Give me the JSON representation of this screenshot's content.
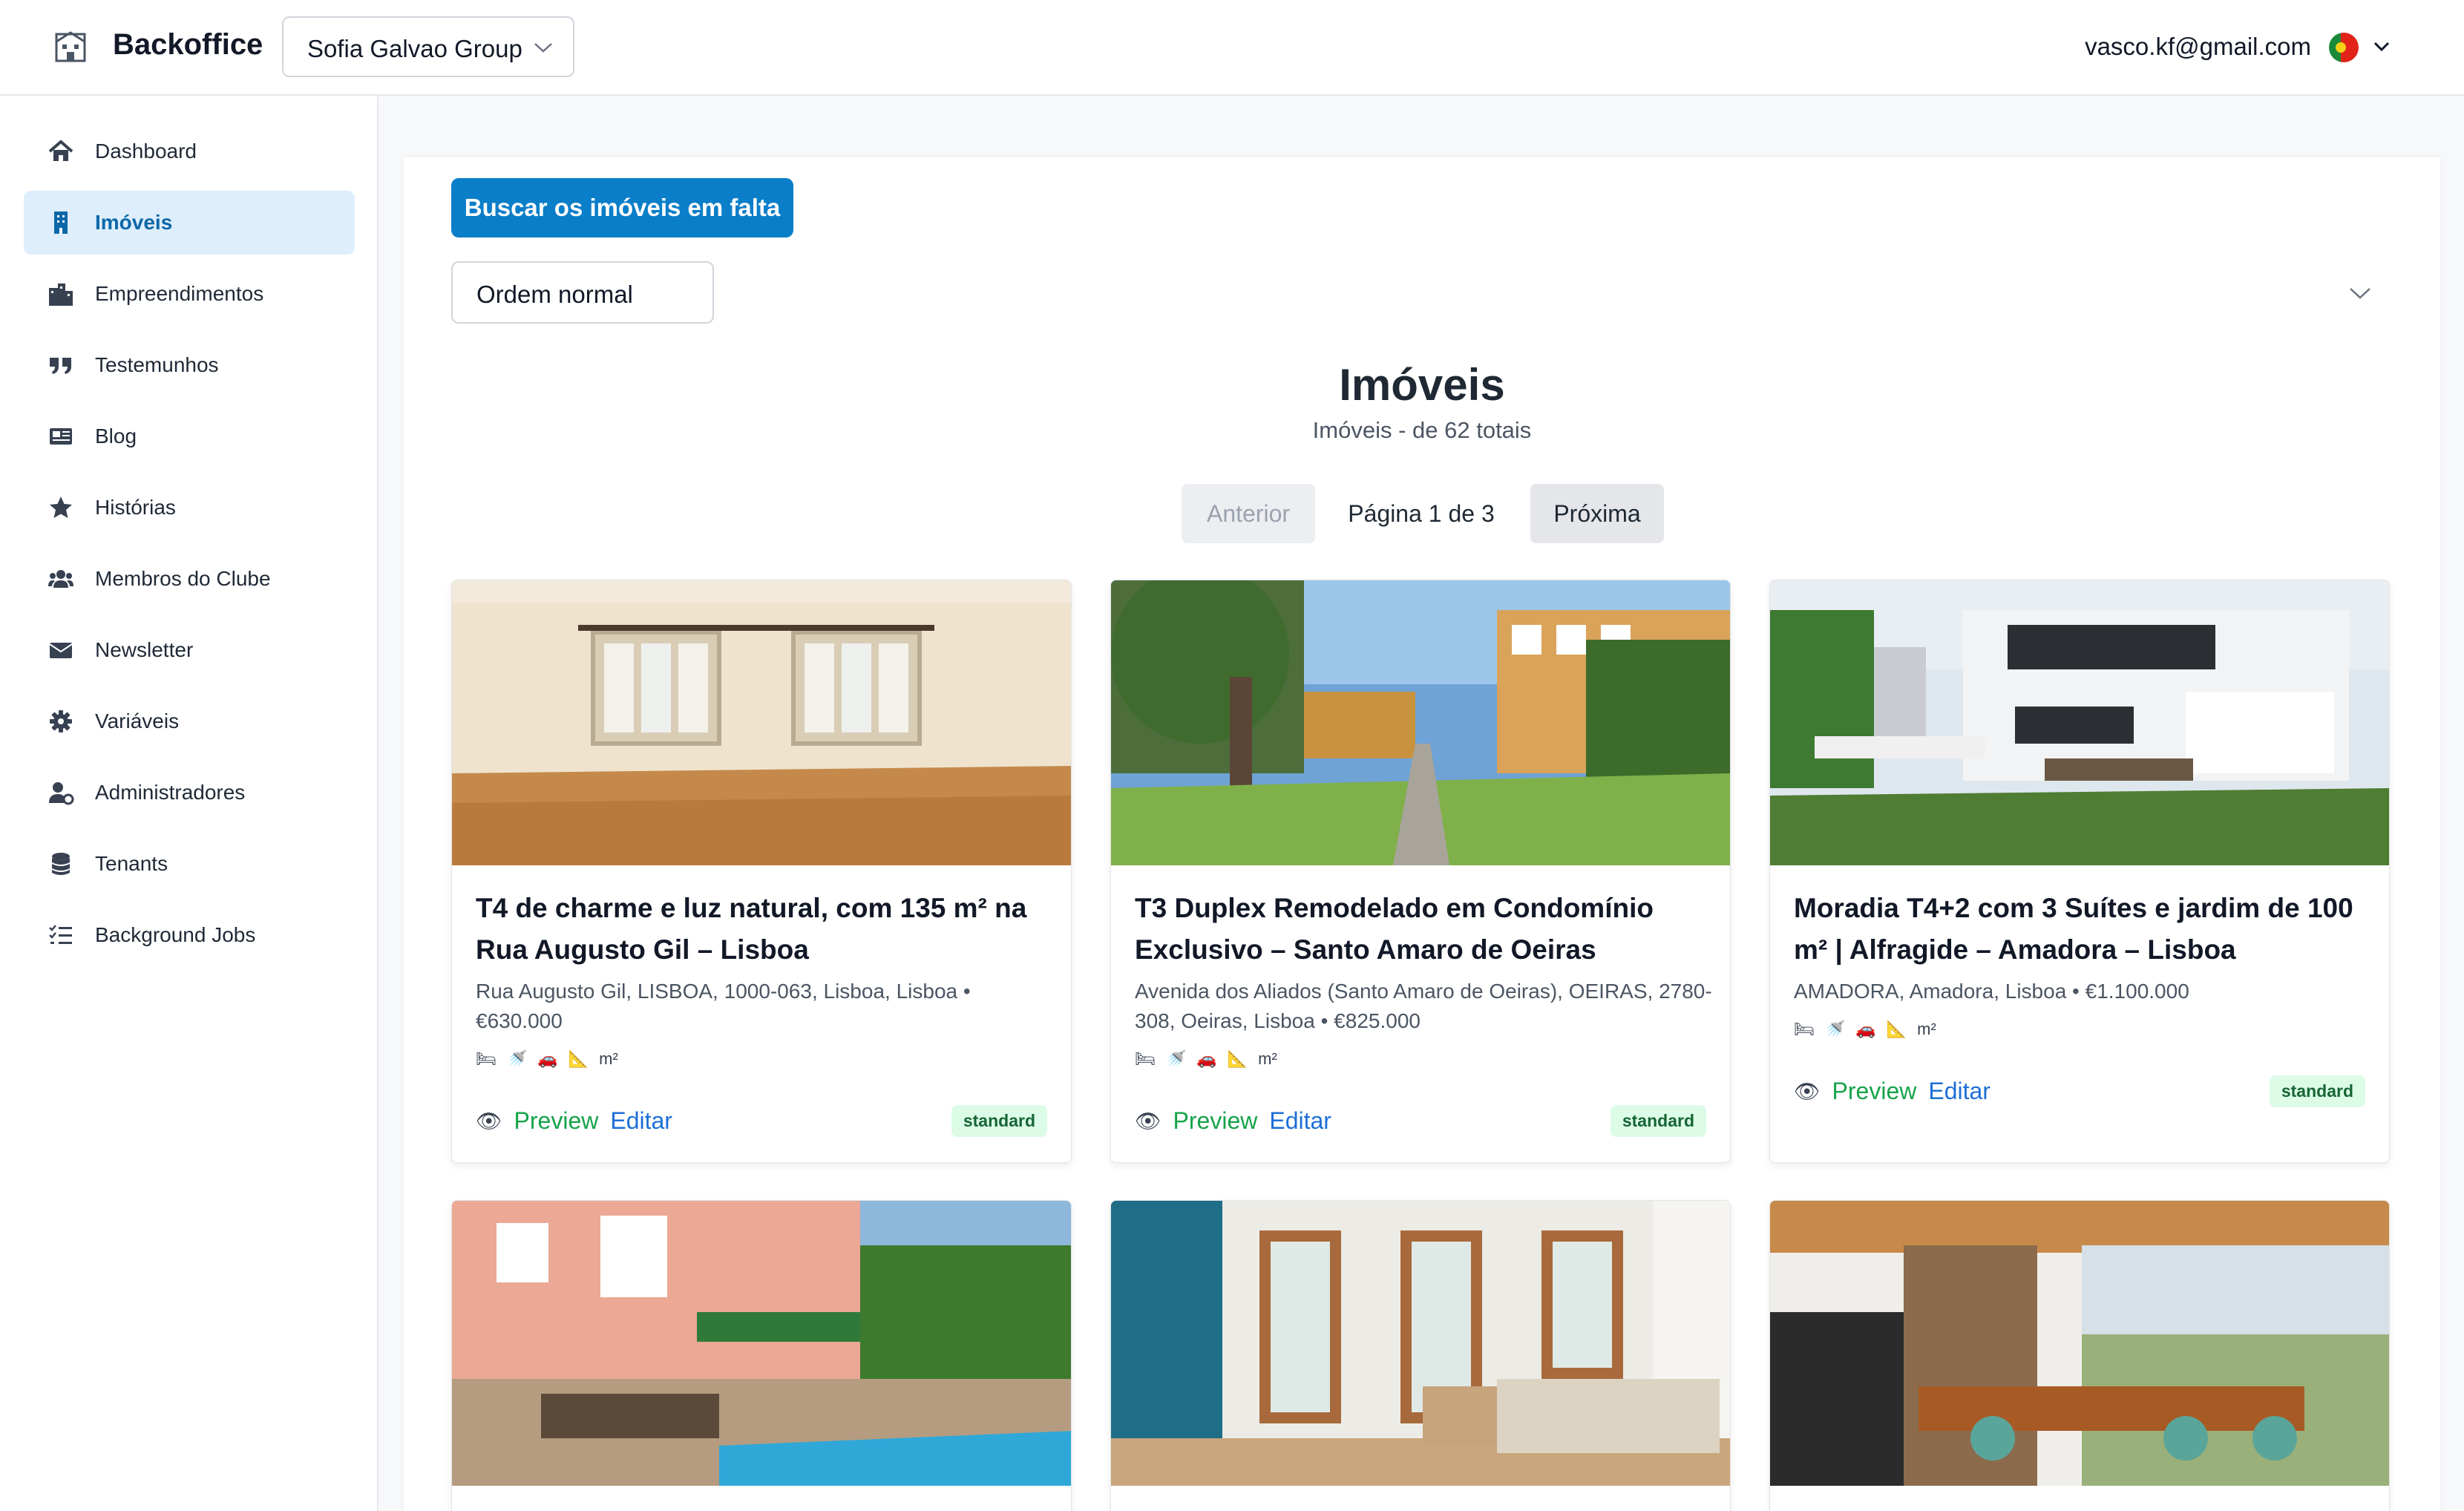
{
  "header": {
    "brand": "Backoffice",
    "tenant_select": "Sofia Galvao Group",
    "user_email": "vasco.kf@gmail.com"
  },
  "sidebar": {
    "items": [
      {
        "label": "Dashboard",
        "icon": "home-icon"
      },
      {
        "label": "Imóveis",
        "icon": "building-icon",
        "active": true
      },
      {
        "label": "Empreendimentos",
        "icon": "city-icon"
      },
      {
        "label": "Testemunhos",
        "icon": "quote-icon"
      },
      {
        "label": "Blog",
        "icon": "newspaper-icon"
      },
      {
        "label": "Histórias",
        "icon": "star-icon"
      },
      {
        "label": "Membros do Clube",
        "icon": "users-icon"
      },
      {
        "label": "Newsletter",
        "icon": "envelope-icon"
      },
      {
        "label": "Variáveis",
        "icon": "gear-icon"
      },
      {
        "label": "Administradores",
        "icon": "user-gear-icon"
      },
      {
        "label": "Tenants",
        "icon": "database-icon"
      },
      {
        "label": "Background Jobs",
        "icon": "list-check-icon"
      }
    ]
  },
  "main": {
    "fetch_button": "Buscar os imóveis em falta",
    "order_select": "Ordem normal",
    "title": "Imóveis",
    "subtitle": "Imóveis - de 62 totais",
    "pagination": {
      "prev": "Anterior",
      "info": "Página 1 de 3",
      "next": "Próxima"
    },
    "cards": [
      {
        "title": "T4 de charme e luz natural, com 135 m² na Rua Augusto Gil – Lisboa",
        "address": "Rua Augusto Gil, LISBOA, 1000-063, Lisboa, Lisboa • €630.000",
        "area_unit": "m²",
        "preview": "Preview",
        "edit": "Editar",
        "badge": "standard"
      },
      {
        "title": "T3 Duplex Remodelado em Condomínio Exclusivo – Santo Amaro de Oeiras",
        "address": "Avenida dos Aliados (Santo Amaro de Oeiras), OEIRAS, 2780-308, Oeiras, Lisboa • €825.000",
        "area_unit": "m²",
        "preview": "Preview",
        "edit": "Editar",
        "badge": "standard"
      },
      {
        "title": "Moradia T4+2 com 3 Suítes e jardim de 100 m² | Alfragide – Amadora – Lisboa",
        "address": "AMADORA, Amadora, Lisboa • €1.100.000",
        "area_unit": "m²",
        "preview": "Preview",
        "edit": "Editar",
        "badge": "standard"
      },
      {
        "title": "",
        "address": ""
      },
      {
        "title": "",
        "address": ""
      },
      {
        "title": "",
        "address": ""
      }
    ]
  },
  "colors": {
    "accent": "#0a7ec9",
    "active_bg": "#deeefc",
    "preview": "#16a34a",
    "edit": "#1d6fd6",
    "badge_bg": "#dcfce7"
  }
}
